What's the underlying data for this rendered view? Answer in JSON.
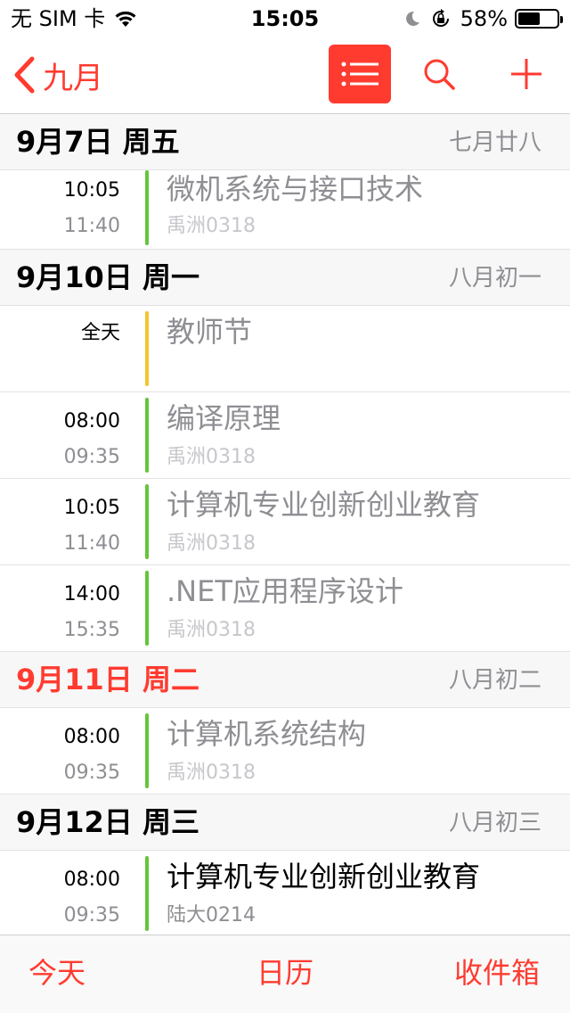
{
  "status_bar": {
    "carrier": "无 SIM 卡",
    "time": "15:05",
    "battery": "58%",
    "battery_level": 0.58
  },
  "nav": {
    "back_label": "九月"
  },
  "colors": {
    "accent": "#ff3b30",
    "green": "#65c53b",
    "yellow": "#f4c430"
  },
  "days": [
    {
      "date": "9月7日 周五",
      "lunar": "七月廿八",
      "events": [
        {
          "start": "10:05",
          "end": "11:40",
          "title": "微机系统与接口技术",
          "location": "禹洲0318"
        }
      ]
    },
    {
      "date": "9月10日 周一",
      "lunar": "八月初一",
      "events": [
        {
          "start": "全天",
          "title": "教师节"
        },
        {
          "start": "08:00",
          "end": "09:35",
          "title": "编译原理",
          "location": "禹洲0318"
        },
        {
          "start": "10:05",
          "end": "11:40",
          "title": "计算机专业创新创业教育",
          "location": "禹洲0318"
        },
        {
          "start": "14:00",
          "end": "15:35",
          "title": ".NET应用程序设计",
          "location": "禹洲0318"
        }
      ]
    },
    {
      "date": "9月11日 周二",
      "lunar": "八月初二",
      "events": [
        {
          "start": "08:00",
          "end": "09:35",
          "title": "计算机系统结构",
          "location": "禹洲0318"
        }
      ]
    },
    {
      "date": "9月12日 周三",
      "lunar": "八月初三",
      "events": [
        {
          "start": "08:00",
          "end": "09:35",
          "title": "计算机专业创新创业教育",
          "location": "陆大0214"
        }
      ]
    }
  ],
  "tabs": {
    "today": "今天",
    "calendars": "日历",
    "inbox": "收件箱"
  }
}
